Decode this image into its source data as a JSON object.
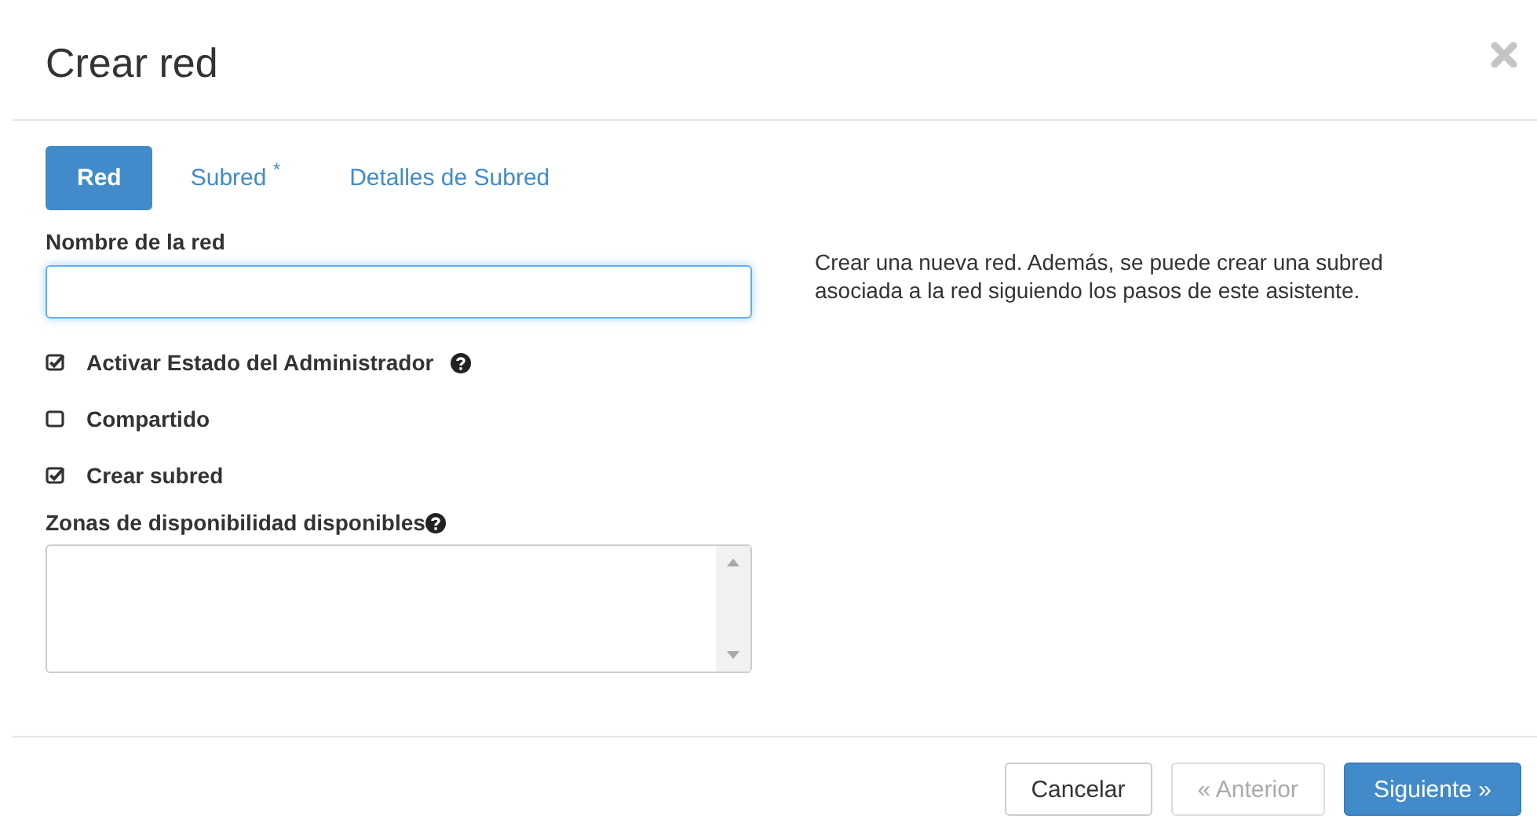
{
  "dialog": {
    "title": "Crear red"
  },
  "tabs": [
    {
      "label": "Red",
      "selected": true
    },
    {
      "label": "Subred $^{*}$",
      "selected": false
    },
    {
      "label": "Detalles de Subred",
      "selected": false
    }
  ],
  "form": {
    "name_field": {
      "label": "Nombre de la red",
      "focused": true
    },
    "options": [
      {
        "label": "Activar Estado del Administrador",
        "checked": true,
        "help": true
      },
      {
        "label": "Compartido",
        "checked": false,
        "help": false
      },
      {
        "label": "Crear subred",
        "checked": true,
        "help": false
      }
    ],
    "zones": {
      "label": "Zonas de disponibilidad disponibles",
      "help": true
    }
  },
  "description": "Crear una nueva red. Además, se puede crear una subred asociada a la red siguiendo los pasos de este asistente.",
  "buttons": [
    {
      "label": "Cancelar",
      "kind": "default",
      "disabled": false
    },
    {
      "label": "« Anterior",
      "kind": "default",
      "disabled": true
    },
    {
      "label": "Siguiente »",
      "kind": "primary",
      "disabled": false
    }
  ]
}
